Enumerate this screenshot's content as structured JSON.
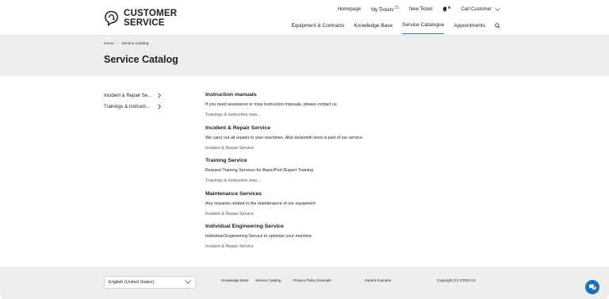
{
  "brand": {
    "line1": "CUSTOMER",
    "line2": "SERVICE"
  },
  "topbar": {
    "homepage": "Homepage",
    "my_tickets": "My Tickets",
    "my_tickets_count": "23",
    "new_ticket": "New Ticket",
    "user": "Carl Customer"
  },
  "nav": {
    "items": [
      {
        "label": "Equipment & Contracts",
        "active": false
      },
      {
        "label": "Knowledge Base",
        "active": false
      },
      {
        "label": "Service Catalogue",
        "active": true
      },
      {
        "label": "Appointments",
        "active": false
      }
    ]
  },
  "breadcrumb": {
    "home": "Home",
    "current": "Service Catalog"
  },
  "page_title": "Service Catalog",
  "sidebar": {
    "items": [
      {
        "label": "Incident & Repair Se..."
      },
      {
        "label": "Trainings & Instructi..."
      }
    ]
  },
  "services": [
    {
      "title": "Instruction manuals",
      "desc": "If you need assistance or miss Instruction manuals, please contact us",
      "category": "Trainings & Instruction man..."
    },
    {
      "title": "Incident & Repair Service",
      "desc": "We carry out all repairs to your machines. Also locksmith work is part of our service.",
      "category": "Incident & Repair Service"
    },
    {
      "title": "Training Service",
      "desc": "Request Training Services for Basic/Prof./Expert Training",
      "category": "Trainings & Instruction man..."
    },
    {
      "title": "Maintenance Services",
      "desc": "Any requests related to the maintenance of our equipment",
      "category": "Incident & Repair Service"
    },
    {
      "title": "Individual Engineering Service",
      "desc": "Individual Engineering Service to optimize your machine.",
      "category": "Incident & Repair Service"
    }
  ],
  "footer": {
    "language": "English (United States)",
    "links": {
      "knowledge_base": "Knowledge Base",
      "service_catalog": "Service Catalog",
      "privacy": "Privacy Policy Example",
      "imprint": "Imprint Example",
      "copyright": "Copyright (C) OTRS AG"
    }
  },
  "colors": {
    "accent": "#1c72b8",
    "banner_bg": "#eeeeee",
    "text": "#1e1e1e"
  },
  "icons": {
    "logo": "customer-service-logo-icon",
    "bell": "bell-icon",
    "search": "search-icon",
    "chat": "chat-icon"
  }
}
